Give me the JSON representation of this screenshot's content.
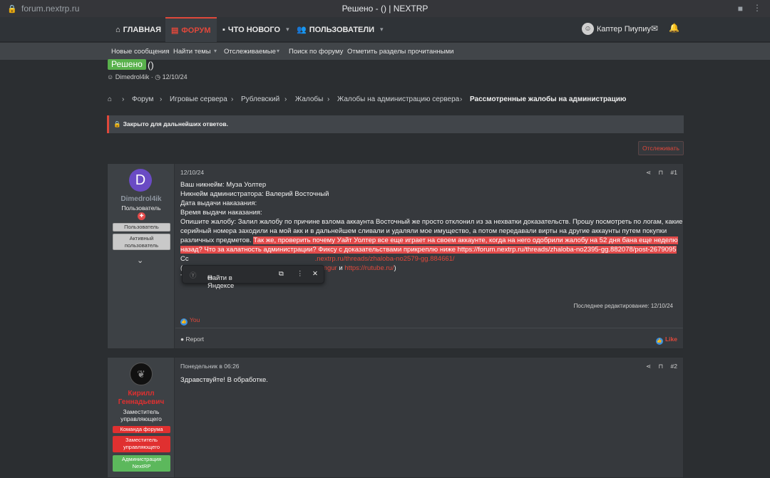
{
  "browser": {
    "url": "forum.nextrp.ru",
    "tab_title": "Решено - () | NEXTRP"
  },
  "nav": {
    "home": "ГЛАВНАЯ",
    "forum": "ФОРУМ",
    "whats_new": "ЧТО НОВОГО",
    "members": "ПОЛЬЗОВАТЕЛИ",
    "username": "Каптер Пиупиу"
  },
  "subnav": [
    "Новые сообщения",
    "Найти темы",
    "Отслеживаемые",
    "Поиск по форуму",
    "Отметить разделы прочитанными"
  ],
  "thread": {
    "status": "Решено",
    "title": "()",
    "author": "Dimedrol4ik",
    "date": "12/10/24"
  },
  "breadcrumbs": [
    "Форум",
    "Игровые сервера",
    "Рублевский",
    "Жалобы",
    "Жалобы на администрацию сервера",
    "Рассмотренные жалобы на администрацию"
  ],
  "closed_notice": "Закрыто для дальнейших ответов.",
  "follow_button": "Отслеживать",
  "post1": {
    "user": {
      "initial": "D",
      "name": "Dimedrol4ik",
      "title": "Пользователь",
      "badge1": "Пользователь",
      "badge2_line1": "Активный",
      "badge2_line2": "пользователь"
    },
    "date": "12/10/24",
    "number": "#1",
    "lines": {
      "l1": "Ваш никнейм: Муза Уолтер",
      "l2": "Никнейм администратора: Валерий Восточный",
      "l3": "Дата выдачи наказания:",
      "l4": "Время выдачи наказания:",
      "l5a": "Опишите жалобу: Залил жалобу по причине взлома аккаунта Восточный же просто отклонил из за нехватки доказательств. Прошу посмотреть по логам, какие серийный номера заходили на мой акк и в дальнейшем сливали и удаляли мое имущество, а потом передавали вирты на другие аккаунты путем покупки различных предметов. ",
      "l5b": "Так же, проверить почему Уайт Уолтер все еще играет на своем аккаунте, когда на него одобрили жалобу на 52 дня бана еще неделю назад? Что за халатность администрации? Фиксу с доказательствами прикреплю ниже https://forum.nextrp.ru/threads/zhaloba-no2395-gg.882078/post-2679095",
      "l6a": "Сс",
      "l6b": ".nextrp.ru/threads/zhaloba-no2579-gg.884661/",
      "l7a": "(с",
      "l7b": "imgur",
      "l7c": " и ",
      "l7d": "https://rutube.ru/",
      "l7e": ")",
      "l8": "Тайм-код:"
    },
    "edited": "Последнее редактирование: 12/10/24",
    "reaction": "You",
    "report": "Report",
    "like": "Like"
  },
  "popup": {
    "search": "Найти в Яндексе"
  },
  "post2": {
    "user": {
      "name_line1": "Кирилл",
      "name_line2": "Геннадьевич",
      "title_line1": "Заместитель",
      "title_line2": "управляющего",
      "badge1": "Команда форума",
      "badge2_line1": "Заместитель",
      "badge2_line2": "управляющего",
      "badge3_line1": "Администрация",
      "badge3_line2": "NextRP"
    },
    "date": "Понедельник в 06:26",
    "number": "#2",
    "text": "Здравствуйте! В обработке."
  }
}
